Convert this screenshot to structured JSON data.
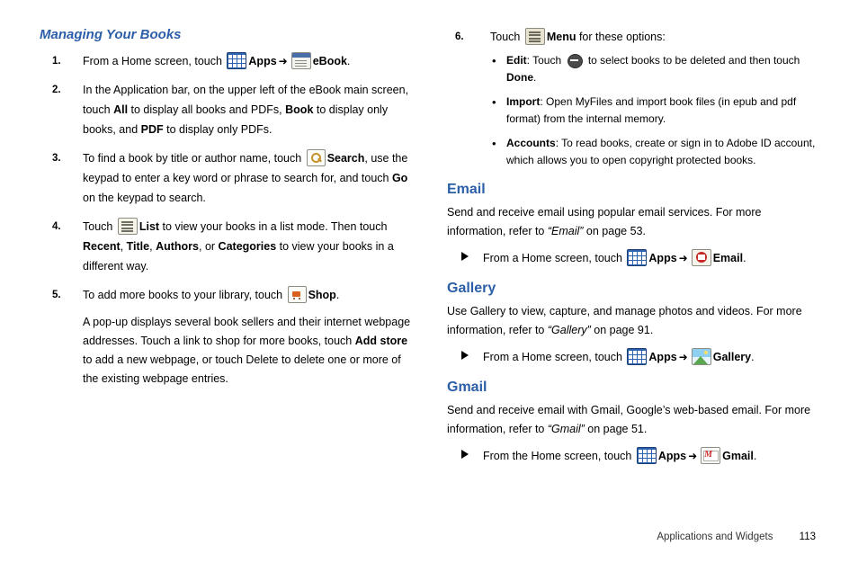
{
  "left": {
    "section_heading": "Managing Your Books",
    "steps": [
      {
        "num": "1.",
        "parts": [
          {
            "t": "text",
            "v": "From a Home screen, touch "
          },
          {
            "t": "icon",
            "v": "apps-icon"
          },
          {
            "t": "bold",
            "v": "Apps"
          },
          {
            "t": "arrow",
            "v": "➜"
          },
          {
            "t": "icon",
            "v": "ebook-icon"
          },
          {
            "t": "bold",
            "v": "eBook"
          },
          {
            "t": "text",
            "v": "."
          }
        ]
      },
      {
        "num": "2.",
        "parts": [
          {
            "t": "text",
            "v": "In the Application bar, on the upper left of the eBook main screen, touch "
          },
          {
            "t": "bold",
            "v": "All"
          },
          {
            "t": "text",
            "v": " to display all books and PDFs, "
          },
          {
            "t": "bold",
            "v": "Book"
          },
          {
            "t": "text",
            "v": " to display only books, and "
          },
          {
            "t": "bold",
            "v": "PDF"
          },
          {
            "t": "text",
            "v": " to display only PDFs."
          }
        ]
      },
      {
        "num": "3.",
        "parts": [
          {
            "t": "text",
            "v": "To find a book by title or author name, touch "
          },
          {
            "t": "icon",
            "v": "search-icon"
          },
          {
            "t": "bold",
            "v": "Search"
          },
          {
            "t": "text",
            "v": ", use the keypad to enter a key word or phrase to search for, and touch "
          },
          {
            "t": "bold",
            "v": "Go"
          },
          {
            "t": "text",
            "v": " on the keypad to search."
          }
        ]
      },
      {
        "num": "4.",
        "parts": [
          {
            "t": "text",
            "v": "Touch "
          },
          {
            "t": "icon",
            "v": "list-icon"
          },
          {
            "t": "bold",
            "v": "List"
          },
          {
            "t": "text",
            "v": " to view your books in a list mode. Then touch "
          },
          {
            "t": "bold",
            "v": "Recent"
          },
          {
            "t": "text",
            "v": ", "
          },
          {
            "t": "bold",
            "v": "Title"
          },
          {
            "t": "text",
            "v": ", "
          },
          {
            "t": "bold",
            "v": "Authors"
          },
          {
            "t": "text",
            "v": ", or "
          },
          {
            "t": "bold",
            "v": "Categories"
          },
          {
            "t": "text",
            "v": " to view your books in a different way."
          }
        ]
      },
      {
        "num": "5.",
        "parts": [
          {
            "t": "text",
            "v": "To add more books to your library, touch "
          },
          {
            "t": "icon",
            "v": "shop-icon"
          },
          {
            "t": "bold",
            "v": "Shop"
          },
          {
            "t": "text",
            "v": "."
          }
        ],
        "followup": [
          {
            "t": "text",
            "v": "A pop-up displays several book sellers and their internet webpage addresses. Touch a link to shop for more books, touch "
          },
          {
            "t": "bold",
            "v": "Add store"
          },
          {
            "t": "text",
            "v": " to add a new webpage, or touch Delete to delete one or more of the existing webpage entries."
          }
        ]
      }
    ]
  },
  "right": {
    "step6": {
      "num": "6.",
      "parts": [
        {
          "t": "text",
          "v": "Touch "
        },
        {
          "t": "icon",
          "v": "menu-icon"
        },
        {
          "t": "bold",
          "v": "Menu"
        },
        {
          "t": "text",
          "v": " for these options:"
        }
      ]
    },
    "bullets": [
      [
        {
          "t": "bold",
          "v": "Edit"
        },
        {
          "t": "text",
          "v": ": Touch "
        },
        {
          "t": "icon",
          "v": "minus-circle-icon"
        },
        {
          "t": "text",
          "v": " to select books to be deleted and then touch "
        },
        {
          "t": "bold",
          "v": "Done"
        },
        {
          "t": "text",
          "v": "."
        }
      ],
      [
        {
          "t": "bold",
          "v": "Import"
        },
        {
          "t": "text",
          "v": ": Open MyFiles and import book files (in epub and pdf format) from the internal memory."
        }
      ],
      [
        {
          "t": "bold",
          "v": "Accounts"
        },
        {
          "t": "text",
          "v": ": To read books, create or sign in to Adobe ID account, which allows you to open copyright protected books."
        }
      ]
    ],
    "sections": [
      {
        "title": "Email",
        "body": [
          {
            "t": "text",
            "v": "Send and receive email using popular email services. For more information, refer to "
          },
          {
            "t": "italic",
            "v": "“Email”"
          },
          {
            "t": "text",
            "v": "  on page 53."
          }
        ],
        "arrow": [
          {
            "t": "text",
            "v": "From a Home screen, touch "
          },
          {
            "t": "icon",
            "v": "apps-icon"
          },
          {
            "t": "bold",
            "v": "Apps"
          },
          {
            "t": "arrow",
            "v": "➜"
          },
          {
            "t": "icon",
            "v": "email-icon"
          },
          {
            "t": "bold",
            "v": "Email"
          },
          {
            "t": "text",
            "v": "."
          }
        ]
      },
      {
        "title": "Gallery",
        "body": [
          {
            "t": "text",
            "v": "Use Gallery to view, capture, and manage photos and videos. For more information, refer to "
          },
          {
            "t": "italic",
            "v": "“Gallery”"
          },
          {
            "t": "text",
            "v": "  on page 91."
          }
        ],
        "arrow": [
          {
            "t": "text",
            "v": "From a Home screen, touch "
          },
          {
            "t": "icon",
            "v": "apps-icon"
          },
          {
            "t": "bold",
            "v": "Apps"
          },
          {
            "t": "arrow",
            "v": "➜"
          },
          {
            "t": "icon",
            "v": "gallery-icon"
          },
          {
            "t": "bold",
            "v": "Gallery"
          },
          {
            "t": "text",
            "v": "."
          }
        ]
      },
      {
        "title": "Gmail",
        "body": [
          {
            "t": "text",
            "v": "Send and receive email with Gmail, Google’s web-based email. For more information, refer to "
          },
          {
            "t": "italic",
            "v": "“Gmail”"
          },
          {
            "t": "text",
            "v": "  on page 51."
          }
        ],
        "arrow": [
          {
            "t": "text",
            "v": "From the Home screen, touch "
          },
          {
            "t": "icon",
            "v": "apps-icon"
          },
          {
            "t": "bold",
            "v": "Apps"
          },
          {
            "t": "arrow",
            "v": "➜"
          },
          {
            "t": "icon",
            "v": "gmail-icon"
          },
          {
            "t": "bold",
            "v": "Gmail"
          },
          {
            "t": "text",
            "v": "."
          }
        ]
      }
    ]
  },
  "footer": {
    "label": "Applications and Widgets",
    "page": "113"
  },
  "colors": {
    "heading_blue": "#2c5fa8",
    "text": "#000000"
  }
}
